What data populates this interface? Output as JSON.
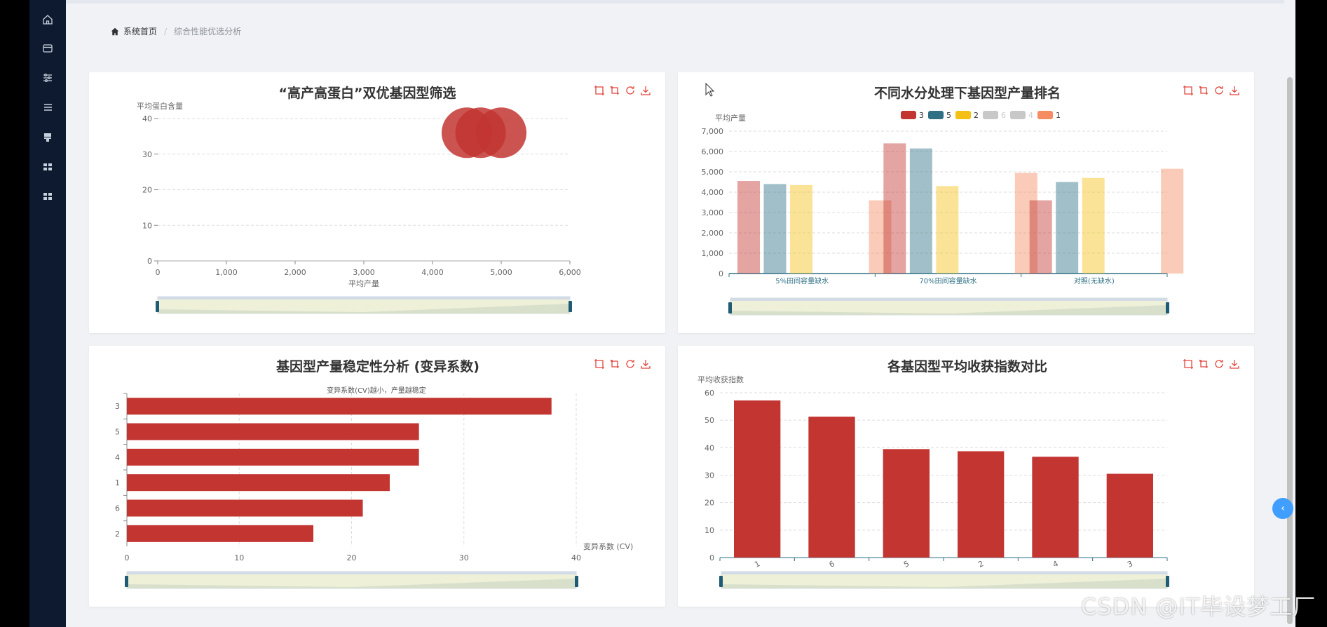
{
  "breadcrumb": {
    "home": "系统首页",
    "current": "综合性能优选分析"
  },
  "sidebar_icons": [
    "home-icon",
    "wallet-icon",
    "sliders-icon",
    "list-icon",
    "stamp-icon",
    "grid-icon",
    "apps-icon"
  ],
  "watermark": "CSDN @IT毕设梦工厂",
  "colors": {
    "red": "#c23531",
    "teal": "#2f4554",
    "palette": [
      "#c23531",
      "#2f7085",
      "#f5c016",
      "#c8c8c8",
      "#c8c8c8",
      "#f58c62"
    ]
  },
  "chart_data": [
    {
      "type": "scatter",
      "title": "“高产高蛋白”双优基因型筛选",
      "xlabel": "平均产量",
      "ylabel": "平均蛋白含量",
      "xlim": [
        0,
        6000
      ],
      "ylim": [
        0,
        40
      ],
      "xticks": [
        "0",
        "1,000",
        "2,000",
        "3,000",
        "4,000",
        "5,000",
        "6,000"
      ],
      "yticks": [
        "0",
        "10",
        "20",
        "30",
        "40"
      ],
      "points": [
        {
          "x": 4500,
          "y": 36
        },
        {
          "x": 4700,
          "y": 36
        },
        {
          "x": 5000,
          "y": 36
        }
      ],
      "grid": true,
      "datazoom": true
    },
    {
      "type": "bar",
      "title": "不同水分处理下基因型产量排名",
      "ylabel": "平均产量",
      "ylim": [
        0,
        7000
      ],
      "yticks": [
        "0",
        "1,000",
        "2,000",
        "3,000",
        "4,000",
        "5,000",
        "6,000",
        "7,000"
      ],
      "categories": [
        "5%田间容量缺水",
        "70%田间容量缺水",
        "对照(无缺水)"
      ],
      "legend": [
        "3",
        "5",
        "2",
        "6",
        "4",
        "1"
      ],
      "series": [
        {
          "name": "3",
          "values": [
            4550,
            6400,
            3600
          ]
        },
        {
          "name": "5",
          "values": [
            4400,
            6150,
            4500
          ]
        },
        {
          "name": "2",
          "values": [
            4350,
            4300,
            4700
          ]
        },
        {
          "name": "6",
          "values": [
            null,
            null,
            null
          ]
        },
        {
          "name": "4",
          "values": [
            null,
            null,
            null
          ]
        },
        {
          "name": "1",
          "values": [
            3600,
            4950,
            5150
          ]
        }
      ],
      "legend_position": "top-center",
      "grid": true,
      "datazoom": true
    },
    {
      "type": "bar",
      "orientation": "horizontal",
      "title": "基因型产量稳定性分析 (变异系数)",
      "subtitle": "变异系数(CV)越小，产量越稳定",
      "xlabel": "变异系数 (CV)",
      "xlim": [
        0,
        40
      ],
      "xticks": [
        "0",
        "10",
        "20",
        "30",
        "40"
      ],
      "categories": [
        "3",
        "5",
        "4",
        "1",
        "6",
        "2"
      ],
      "values": [
        37.8,
        26,
        26,
        23.4,
        21,
        16.6
      ],
      "grid": true,
      "datazoom": true
    },
    {
      "type": "bar",
      "title": "各基因型平均收获指数对比",
      "ylabel": "平均收获指数",
      "ylim": [
        0,
        60
      ],
      "yticks": [
        "0",
        "10",
        "20",
        "30",
        "40",
        "50",
        "60"
      ],
      "categories": [
        "1",
        "6",
        "5",
        "2",
        "4",
        "3"
      ],
      "values": [
        57.2,
        51.3,
        39.5,
        38.7,
        36.7,
        30.5
      ],
      "grid": true,
      "datazoom": true
    }
  ]
}
